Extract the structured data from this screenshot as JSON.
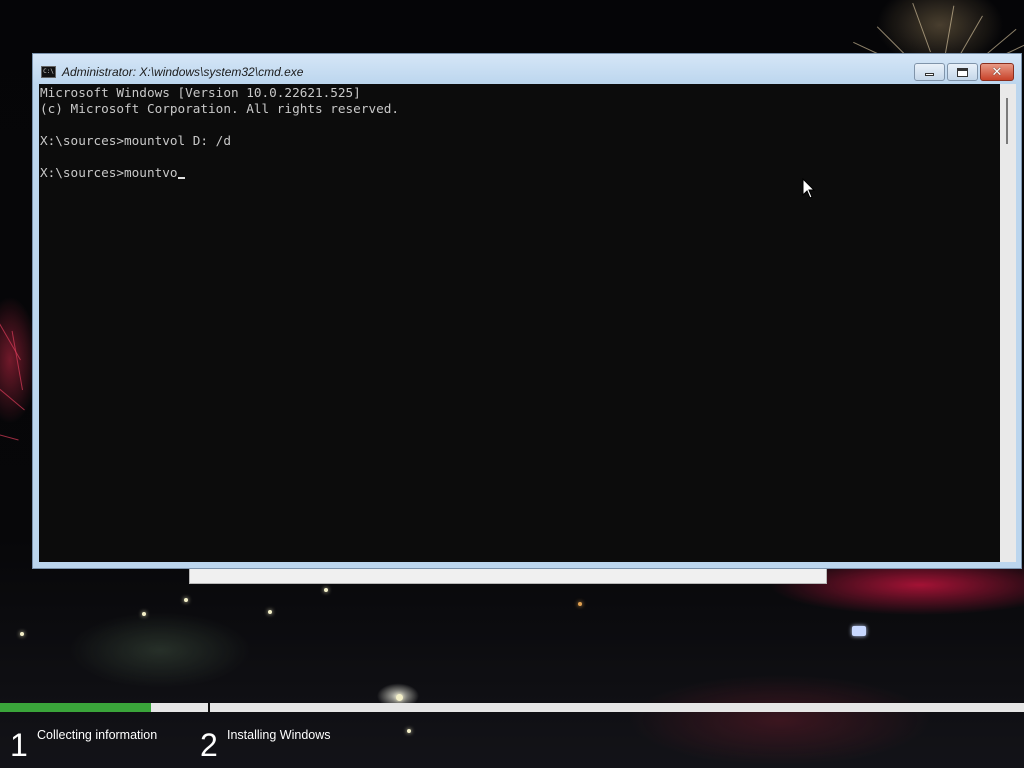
{
  "window": {
    "title": "Administrator: X:\\windows\\system32\\cmd.exe",
    "icon": "console-icon",
    "controls": {
      "minimize": "minimize-icon",
      "maximize": "maximize-icon",
      "close": "✕"
    }
  },
  "console": {
    "lines": [
      "Microsoft Windows [Version 10.0.22621.525]",
      "(c) Microsoft Corporation. All rights reserved.",
      "",
      "X:\\sources>mountvol D: /d",
      "",
      "X:\\sources>mountvo"
    ]
  },
  "setup": {
    "progress_fraction": 0.147,
    "steps": [
      {
        "number": "1",
        "label": "Collecting information"
      },
      {
        "number": "2",
        "label": "Installing Windows"
      }
    ]
  },
  "colors": {
    "console_bg": "#0c0c0c",
    "console_text": "#c8c8c8",
    "progress_green": "#3aa53a",
    "window_frame": "#bcd6ee"
  }
}
